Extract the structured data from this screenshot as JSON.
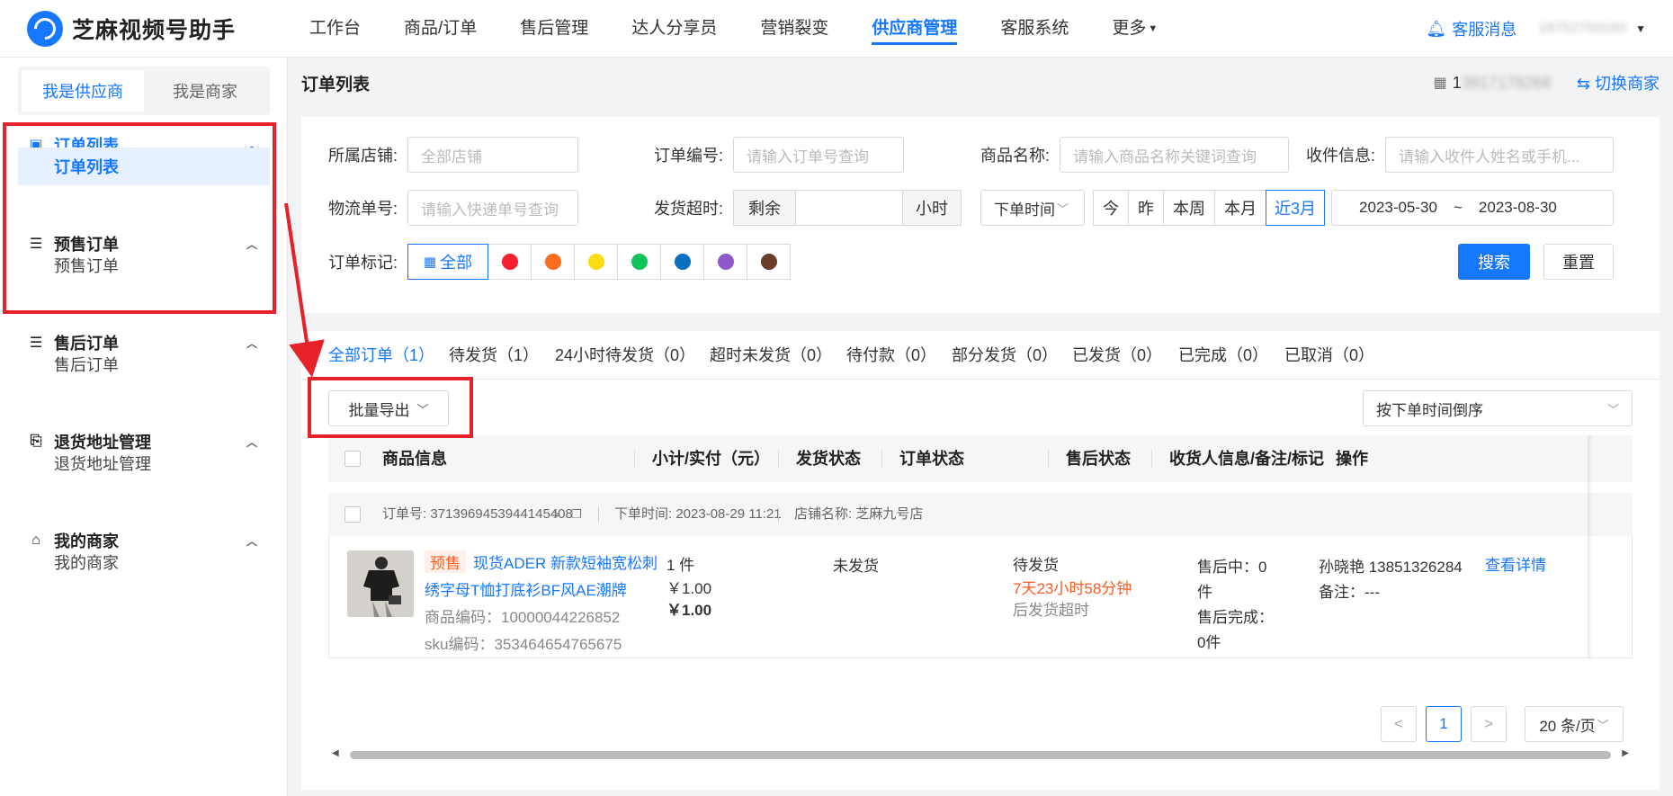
{
  "app": {
    "name": "芝麻视频号助手"
  },
  "nav": {
    "items": [
      "工作台",
      "商品/订单",
      "售后管理",
      "达人分享员",
      "营销裂变",
      "供应商管理",
      "客服系统",
      "更多"
    ],
    "active": "供应商管理"
  },
  "header": {
    "message_label": "客服消息",
    "user_phone": "18752750160"
  },
  "sidebar": {
    "roles": [
      "我是供应商",
      "我是商家"
    ],
    "active_role": "我是供应商",
    "groups": [
      {
        "title": "订单列表",
        "icon": "order-list-icon",
        "sub": "订单列表"
      },
      {
        "title": "预售订单",
        "icon": "presale-icon",
        "sub": "预售订单"
      },
      {
        "title": "售后订单",
        "icon": "aftersale-icon",
        "sub": "售后订单"
      },
      {
        "title": "退货地址管理",
        "icon": "return-address-icon",
        "sub": "退货地址管理"
      },
      {
        "title": "我的商家",
        "icon": "merchant-icon",
        "sub": "我的商家"
      }
    ]
  },
  "page": {
    "title": "订单列表",
    "store_prefix": "1",
    "store_blurred": "3917178268",
    "switch_label": "切换商家"
  },
  "filters": {
    "store_label": "所属店铺:",
    "store_placeholder": "全部店铺",
    "order_no_label": "订单编号:",
    "order_no_placeholder": "请输入订单号查询",
    "product_label": "商品名称:",
    "product_placeholder": "请输入商品名称关键词查询",
    "receiver_label": "收件信息:",
    "receiver_placeholder": "请输入收件人姓名或手机...",
    "logistics_label": "物流单号:",
    "logistics_placeholder": "请输入快递单号查询",
    "overdue_label": "发货超时:",
    "overdue_prefix": "剩余",
    "overdue_suffix": "小时",
    "time_type": "下单时间",
    "quick_ranges": [
      "今",
      "昨",
      "本周",
      "本月",
      "近3月"
    ],
    "quick_active": "近3月",
    "date_start": "2023-05-30",
    "date_sep": "~",
    "date_end": "2023-08-30",
    "mark_label": "订单标记:",
    "mark_all": "全部",
    "mark_colors": [
      "#f5222d",
      "#fa6d1c",
      "#fadb14",
      "#12c25a",
      "#0b6fbf",
      "#8e5ac9",
      "#6b3d2b"
    ],
    "search_btn": "搜索",
    "reset_btn": "重置"
  },
  "tabs": [
    {
      "label": "全部订单（1）",
      "active": true
    },
    {
      "label": "待发货（1）"
    },
    {
      "label": "24小时待发货（0）"
    },
    {
      "label": "超时未发货（0）"
    },
    {
      "label": "待付款（0）"
    },
    {
      "label": "部分发货（0）"
    },
    {
      "label": "已发货（0）"
    },
    {
      "label": "已完成（0）"
    },
    {
      "label": "已取消（0）"
    }
  ],
  "toolbar": {
    "export_label": "批量导出",
    "sort_label": "按下单时间倒序"
  },
  "table": {
    "columns": [
      "商品信息",
      "小计/实付（元）",
      "发货状态",
      "订单状态",
      "售后状态",
      "收货人信息/备注/标记",
      "操作"
    ]
  },
  "order": {
    "no_label": "订单号:",
    "no": "371396945394414540 8",
    "no_value": "3713969453944145408",
    "time_label": "下单时间:",
    "time": "2023-08-29 11:21",
    "shop_label": "店铺名称:",
    "shop": "芝麻九号店",
    "tag": "预售",
    "title_line1": "现货ADER 新款短袖宽松刺",
    "title_line2": "绣字母T恤打底衫BF风AE潮牌",
    "product_code": "商品编码：10000044226852",
    "sku_code": "sku编码：353464654765675",
    "qty": "1 件",
    "subtotal": "￥1.00",
    "paid": "￥1.00",
    "ship_status": "未发货",
    "order_status": "待发货",
    "countdown": "7天23小时58分钟",
    "countdown_suffix": "后发货超时",
    "aftersale_line1": "售后中：0",
    "aftersale_line2": "件",
    "aftersale_line3": "售后完成：",
    "aftersale_line4": "0件",
    "receiver": "孙晓艳 13851326284",
    "remark": "备注：---",
    "action": "查看详情"
  },
  "pager": {
    "prev": "<",
    "current": "1",
    "next": ">",
    "page_size": "20 条/页"
  }
}
